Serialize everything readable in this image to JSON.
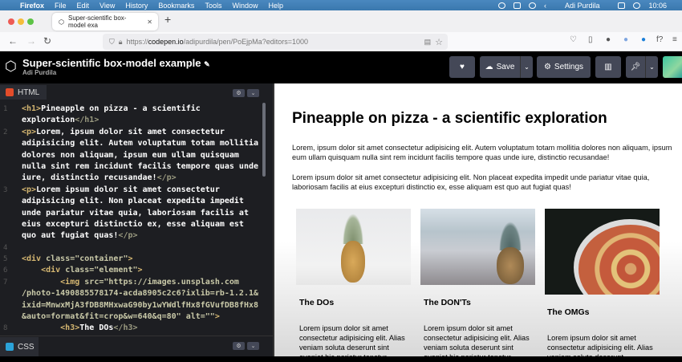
{
  "menubar": {
    "app": "Firefox",
    "items": [
      "File",
      "Edit",
      "View",
      "History",
      "Bookmarks",
      "Tools",
      "Window",
      "Help"
    ],
    "user": "Adi Purdila",
    "time": "10:06"
  },
  "browser": {
    "tab_title": "Super-scientific box-model exa",
    "url_prefix": "https://",
    "url_domain": "codepen.io",
    "url_path": "/adipurdila/pen/PoEjpMa?editors=1000"
  },
  "codepen": {
    "title": "Super-scientific box-model example",
    "author": "Adi Purdila",
    "save_label": "Save",
    "settings_label": "Settings"
  },
  "editor": {
    "html_tab": "HTML",
    "css_tab": "CSS",
    "lines": [
      {
        "n": "1",
        "segs": [
          [
            "tag",
            "<h1>"
          ],
          [
            "txt",
            "Pineapple on pizza - a scientific"
          ]
        ]
      },
      {
        "n": "",
        "segs": [
          [
            "txt",
            "exploration"
          ],
          [
            "ctag",
            "</h1>"
          ]
        ]
      },
      {
        "n": "2",
        "segs": [
          [
            "tag",
            "<p>"
          ],
          [
            "txt",
            "Lorem, ipsum dolor sit amet consectetur"
          ]
        ]
      },
      {
        "n": "",
        "segs": [
          [
            "txt",
            "adipisicing elit. Autem voluptatum totam mollitia"
          ]
        ]
      },
      {
        "n": "",
        "segs": [
          [
            "txt",
            "dolores non aliquam, ipsum eum ullam quisquam"
          ]
        ]
      },
      {
        "n": "",
        "segs": [
          [
            "txt",
            "nulla sint rem incidunt facilis tempore quas unde"
          ]
        ]
      },
      {
        "n": "",
        "segs": [
          [
            "txt",
            "iure, distinctio recusandae!"
          ],
          [
            "ctag",
            "</p>"
          ]
        ]
      },
      {
        "n": "3",
        "segs": [
          [
            "tag",
            "<p>"
          ],
          [
            "txt",
            "Lorem ipsum dolor sit amet consectetur"
          ]
        ]
      },
      {
        "n": "",
        "segs": [
          [
            "txt",
            "adipisicing elit. Non placeat expedita impedit"
          ]
        ]
      },
      {
        "n": "",
        "segs": [
          [
            "txt",
            "unde pariatur vitae quia, laboriosam facilis at"
          ]
        ]
      },
      {
        "n": "",
        "segs": [
          [
            "txt",
            "eius excepturi distinctio ex, esse aliquam est"
          ]
        ]
      },
      {
        "n": "",
        "segs": [
          [
            "txt",
            "quo aut fugiat quas!"
          ],
          [
            "ctag",
            "</p>"
          ]
        ]
      },
      {
        "n": "4",
        "segs": [
          [
            "txt",
            ""
          ]
        ]
      },
      {
        "n": "5",
        "segs": [
          [
            "tag",
            "<div "
          ],
          [
            "str",
            "class=\"container\""
          ],
          [
            "tag",
            ">"
          ]
        ]
      },
      {
        "n": "6",
        "segs": [
          [
            "tag",
            "    <div "
          ],
          [
            "str",
            "class=\"element\""
          ],
          [
            "tag",
            ">"
          ]
        ]
      },
      {
        "n": "7",
        "segs": [
          [
            "tag",
            "        <img "
          ],
          [
            "str",
            "src=\"https://images.unsplash.com"
          ]
        ]
      },
      {
        "n": "",
        "segs": [
          [
            "str",
            "/photo-1490885578174-acda8905c2c6?ixlib=rb-1.2.1&"
          ]
        ]
      },
      {
        "n": "",
        "segs": [
          [
            "str",
            "ixid=MnwxMjA3fDB8MHxwaG90by1wYWdlfHx8fGVufDB8fHx8"
          ]
        ]
      },
      {
        "n": "",
        "segs": [
          [
            "str",
            "&auto=format&fit=crop&w=640&q=80\" alt=\"\""
          ],
          [
            "tag",
            ">"
          ]
        ]
      },
      {
        "n": "8",
        "segs": [
          [
            "tag",
            "        <h3>"
          ],
          [
            "txt",
            "The DOs"
          ],
          [
            "ctag",
            "</h3>"
          ]
        ]
      }
    ]
  },
  "preview": {
    "h1": "Pineapple on pizza - a scientific exploration",
    "p1": "Lorem, ipsum dolor sit amet consectetur adipisicing elit. Autem voluptatum totam mollitia dolores non aliquam, ipsum eum ullam quisquam nulla sint rem incidunt facilis tempore quas unde iure, distinctio recusandae!",
    "p2": "Lorem ipsum dolor sit amet consectetur adipisicing elit. Non placeat expedita impedit unde pariatur vitae quia, laboriosam facilis at eius excepturi distinctio ex, esse aliquam est quo aut fugiat quas!",
    "cards": [
      {
        "title": "The DOs",
        "text": "Lorem ipsum dolor sit amet consectetur adipisicing elit. Alias veniam soluta deserunt sint eveniet hic pariatur tenetur"
      },
      {
        "title": "The DON'Ts",
        "text": "Lorem ipsum dolor sit amet consectetur adipisicing elit. Alias veniam soluta deserunt sint eveniet hic pariatur tenetur"
      },
      {
        "title": "The OMGs",
        "text": "Lorem ipsum dolor sit amet consectetur adipisicing elit. Alias veniam soluta deserunt"
      }
    ]
  }
}
